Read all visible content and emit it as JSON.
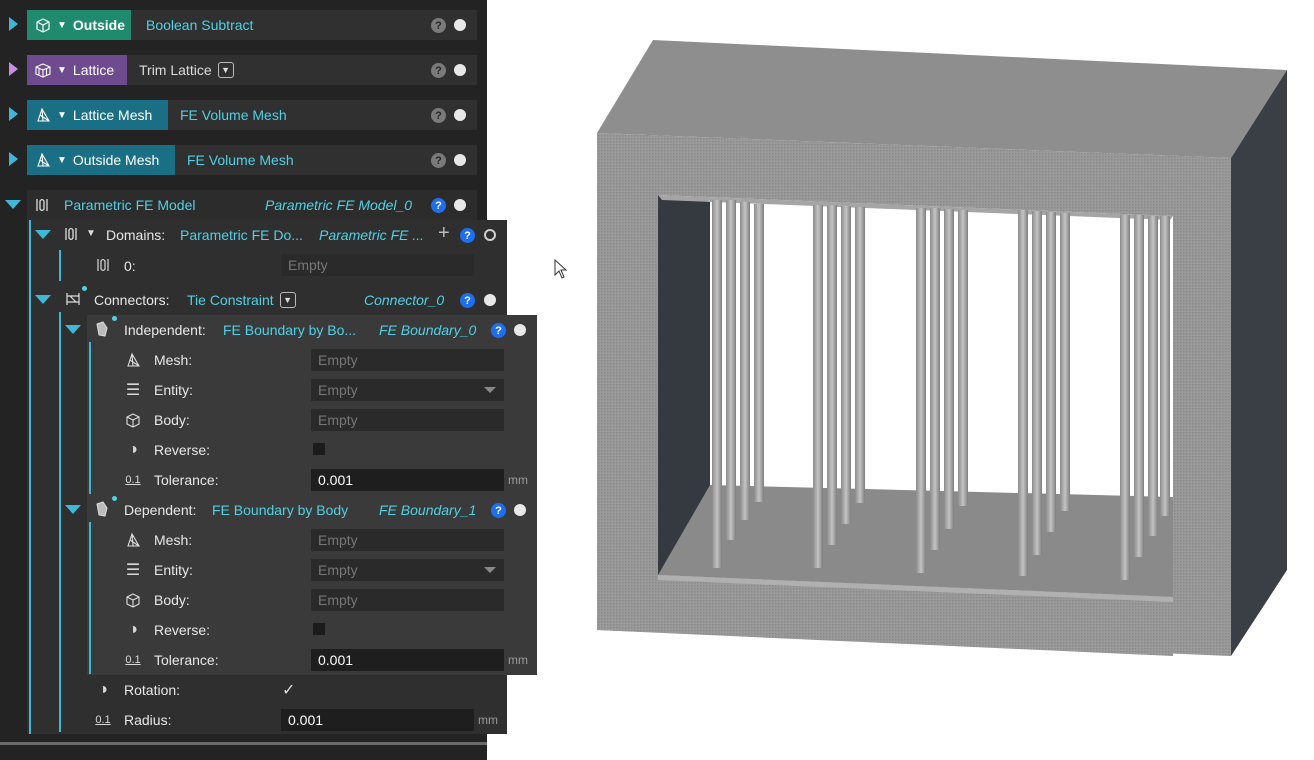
{
  "nodes": [
    {
      "tag": "Outside",
      "op": "Boolean Subtract"
    },
    {
      "tag": "Lattice",
      "op": "Trim Lattice"
    },
    {
      "tag": "Lattice Mesh",
      "op": "FE Volume Mesh"
    },
    {
      "tag": "Outside Mesh",
      "op": "FE Volume Mesh"
    }
  ],
  "fe_model": {
    "label": "Parametric FE Model",
    "value": "Parametric FE Model_0",
    "domains": {
      "label": "Domains:",
      "type": "Parametric FE Do...",
      "value": "Parametric FE ...",
      "item_label": "0:",
      "item_value": "Empty"
    },
    "connectors": {
      "label": "Connectors:",
      "type": "Tie Constraint",
      "value": "Connector_0",
      "independent": {
        "label": "Independent:",
        "type": "FE Boundary by Bo...",
        "value": "FE Boundary_0",
        "mesh_label": "Mesh:",
        "mesh_value": "Empty",
        "entity_label": "Entity:",
        "entity_value": "Empty",
        "body_label": "Body:",
        "body_value": "Empty",
        "reverse_label": "Reverse:",
        "tolerance_label": "Tolerance:",
        "tolerance_value": "0.001",
        "tolerance_unit": "mm",
        "tol_icon": "0.1"
      },
      "dependent": {
        "label": "Dependent:",
        "type": "FE Boundary by Body",
        "value": "FE Boundary_1",
        "mesh_label": "Mesh:",
        "mesh_value": "Empty",
        "entity_label": "Entity:",
        "entity_value": "Empty",
        "body_label": "Body:",
        "body_value": "Empty",
        "reverse_label": "Reverse:",
        "tolerance_label": "Tolerance:",
        "tolerance_value": "0.001",
        "tolerance_unit": "mm",
        "tol_icon": "0.1"
      },
      "rotation_label": "Rotation:",
      "rotation_check": "✓",
      "radius_label": "Radius:",
      "radius_value": "0.001",
      "radius_unit": "mm",
      "radius_icon": "0.1"
    }
  },
  "help_glyph": "?",
  "add_glyph": "+",
  "colors": {
    "panel_bg": "#232323",
    "row_bg": "#303030",
    "accent_cyan": "#4fd1e6",
    "outside_tag": "#1f8a6e",
    "lattice_tag": "#6e4a8e",
    "mesh_tag": "#1a6f84",
    "help_blue": "#1e6ff0"
  },
  "icons": [
    "expand-arrow-icon",
    "collapse-arrow-icon",
    "lattice-cube-icon",
    "mesh-triangle-icon",
    "fe-model-icon",
    "connector-icon",
    "boundary-icon",
    "list-icon",
    "contrast-icon",
    "help-icon",
    "visibility-dot-icon",
    "add-icon",
    "cursor-icon"
  ]
}
